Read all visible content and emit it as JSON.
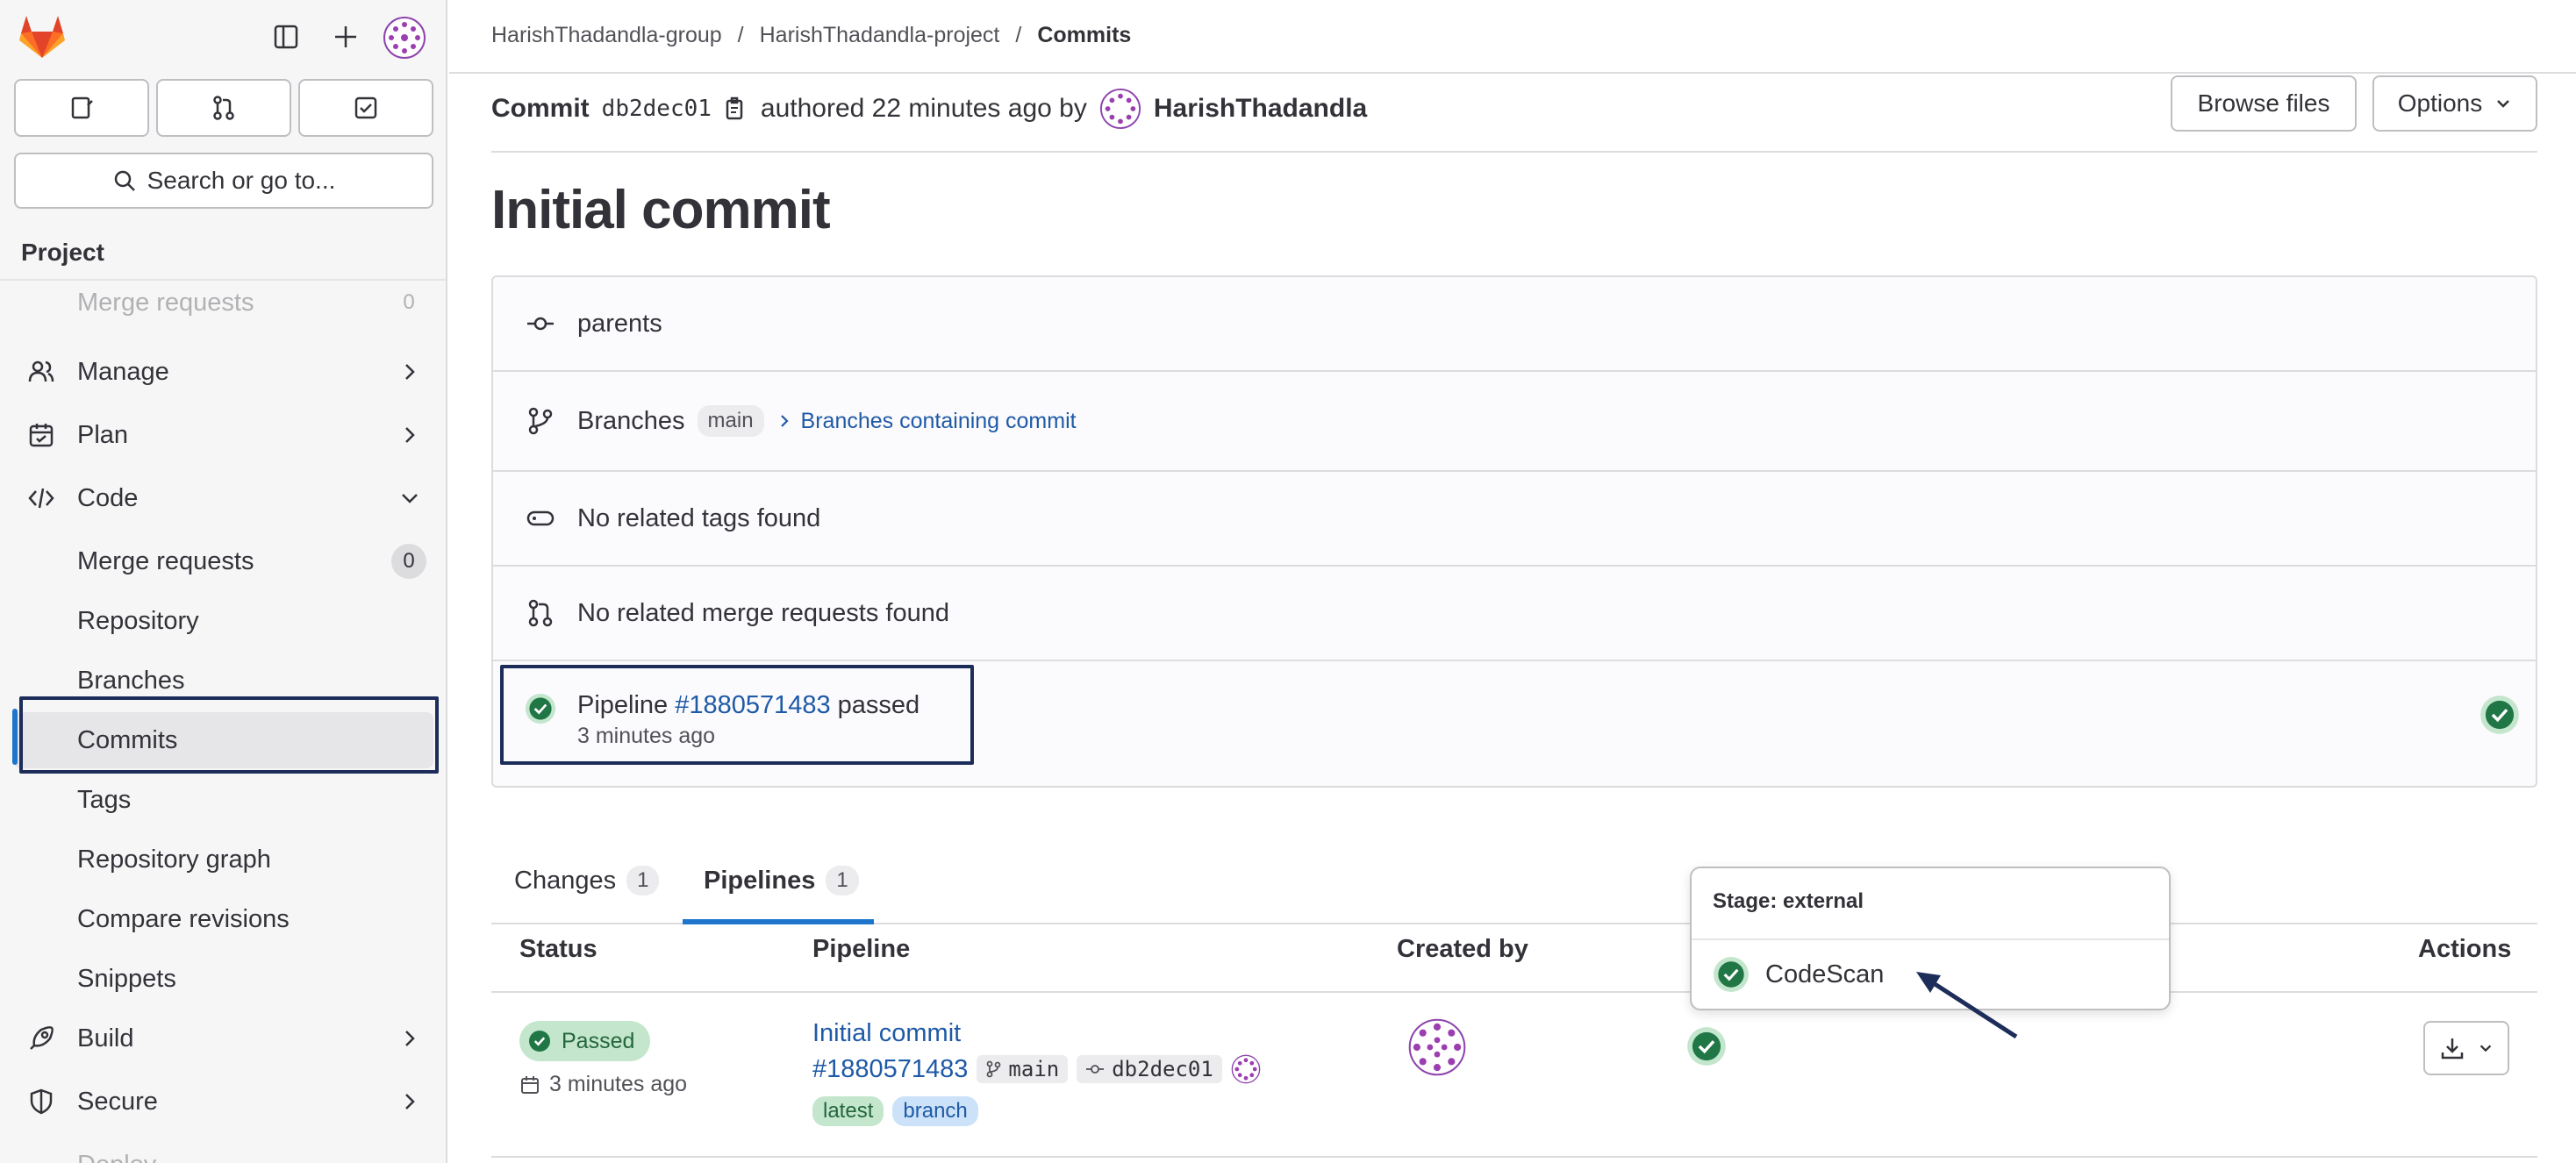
{
  "sidebar": {
    "section_title": "Project",
    "search_label": "Search or go to...",
    "items": [
      {
        "label": "Merge requests",
        "count": "0"
      },
      {
        "label": "Manage"
      },
      {
        "label": "Plan"
      },
      {
        "label": "Code"
      },
      {
        "label": "Merge requests",
        "count": "0"
      },
      {
        "label": "Repository"
      },
      {
        "label": "Branches"
      },
      {
        "label": "Commits"
      },
      {
        "label": "Tags"
      },
      {
        "label": "Repository graph"
      },
      {
        "label": "Compare revisions"
      },
      {
        "label": "Snippets"
      },
      {
        "label": "Build"
      },
      {
        "label": "Secure"
      },
      {
        "label": "Deploy"
      }
    ]
  },
  "breadcrumb": {
    "group": "HarishThadandla-group",
    "project": "HarishThadandla-project",
    "current": "Commits",
    "sep": "/"
  },
  "commit": {
    "prefix": "Commit",
    "hash": "db2dec01",
    "authored": "authored 22 minutes ago by",
    "author": "HarishThadandla",
    "title": "Initial commit",
    "browse_files": "Browse files",
    "options": "Options"
  },
  "info": {
    "parents": "parents",
    "branches_label": "Branches",
    "branch": "main",
    "branches_link": "Branches containing commit",
    "tags": "No related tags found",
    "merge_requests": "No related merge requests found",
    "pipeline_prefix": "Pipeline",
    "pipeline_id": "#1880571483",
    "pipeline_status": "passed",
    "pipeline_time": "3 minutes ago"
  },
  "tabs": [
    {
      "label": "Changes",
      "count": "1"
    },
    {
      "label": "Pipelines",
      "count": "1"
    }
  ],
  "table": {
    "headers": {
      "status": "Status",
      "pipeline": "Pipeline",
      "created_by": "Created by",
      "actions": "Actions"
    },
    "row": {
      "status": "Passed",
      "time": "3 minutes ago",
      "title": "Initial commit",
      "id": "#1880571483",
      "branch": "main",
      "hash": "db2dec01",
      "tag1": "latest",
      "tag2": "branch"
    }
  },
  "popover": {
    "stage": "Stage: external",
    "job": "CodeScan"
  },
  "colors": {
    "success": "#217645",
    "link": "#1f5aa6",
    "accent": "#1f75cb",
    "focus": "#1d2d5a"
  }
}
